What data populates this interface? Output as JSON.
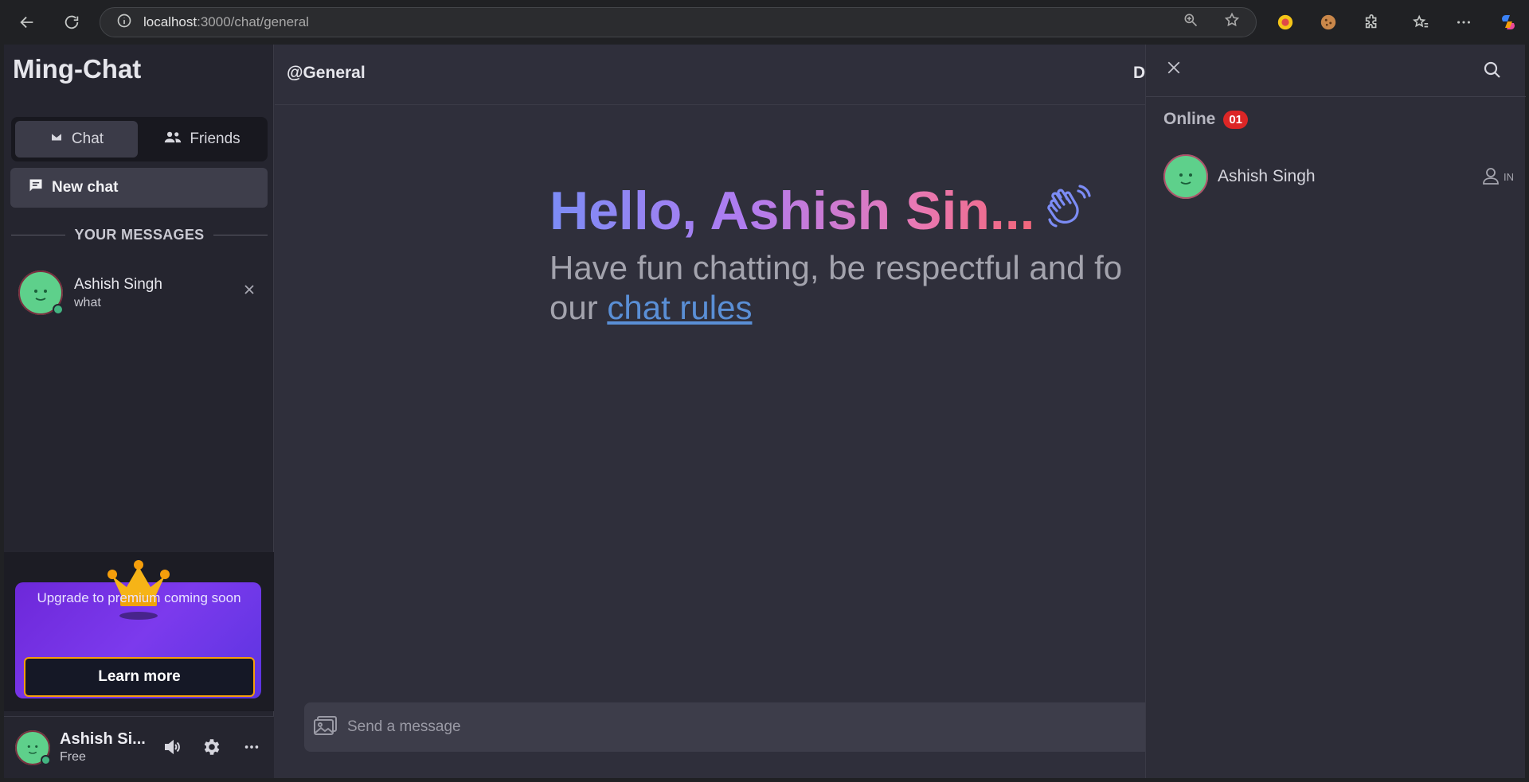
{
  "browser": {
    "url_host": "localhost",
    "url_path": ":3000/chat/general"
  },
  "sidebar": {
    "brand": "Ming-Chat",
    "tabs": [
      {
        "label": "Chat",
        "icon": "envelope-icon",
        "active": true
      },
      {
        "label": "Friends",
        "icon": "people-icon",
        "active": false
      }
    ],
    "new_chat_label": "New chat",
    "section_title": "YOUR MESSAGES",
    "messages": [
      {
        "name": "Ashish Singh",
        "preview": "what",
        "online": true
      }
    ],
    "premium": {
      "text": "Upgrade to premium coming soon",
      "button": "Learn more"
    },
    "user": {
      "name": "Ashish Si...",
      "plan": "Free"
    }
  },
  "chat": {
    "channel": "@General",
    "header_right_truncated": "Da",
    "greeting": "Hello, Ashish Sin...",
    "welcome_line": "Have fun chatting, be respectful and fo",
    "welcome_prefix": "our",
    "rules_link": "chat rules",
    "composer_placeholder": "Send a message"
  },
  "members_panel": {
    "online_label": "Online",
    "online_count": "01",
    "members": [
      {
        "name": "Ashish Singh",
        "country": "IN"
      }
    ]
  },
  "colors": {
    "accent_premium": "#7c3aed",
    "online_green": "#43b581",
    "badge_red": "#dc2626",
    "avatar_green": "#5ed08b"
  }
}
